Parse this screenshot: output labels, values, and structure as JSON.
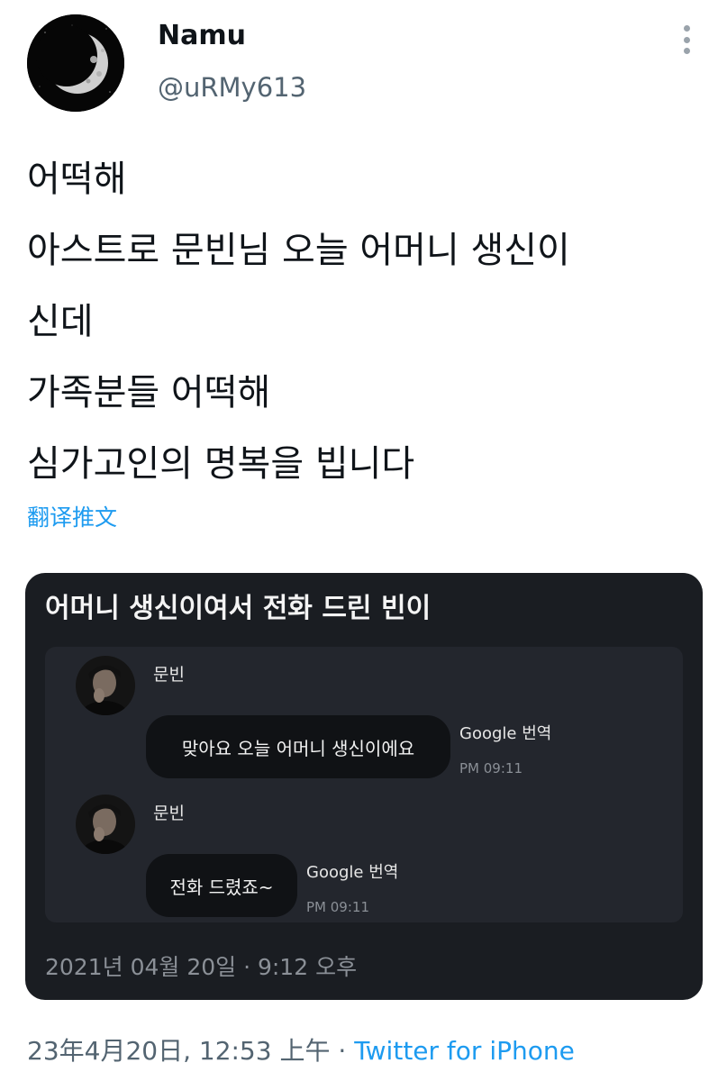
{
  "tweet": {
    "author": {
      "display_name": "Namu",
      "handle": "@uRMy613",
      "avatar_icon": "moon-avatar"
    },
    "more_icon": "more-vertical-icon",
    "text_lines": [
      "어떡해",
      "아스트로 문빈님 오늘 어머니 생신이",
      "신데",
      "가족분들 어떡해",
      "심가고인의 명복을 빕니다"
    ],
    "translate_label": "翻译推文",
    "timestamp": "23年4月20日, 12:53 上午",
    "separator": "·",
    "source": "Twitter for iPhone"
  },
  "media": {
    "title": "어머니 생신이여서 전화 드린 빈이",
    "messages": [
      {
        "sender": "문빈",
        "text": "맞아요 오늘 어머니 생신이에요",
        "translate": "Google 번역",
        "time": "PM 09:11"
      },
      {
        "sender": "문빈",
        "text": "전화 드렸죠~",
        "translate": "Google 번역",
        "time": "PM 09:11"
      }
    ],
    "date_footer": "2021년 04월 20일 · 9:12 오후"
  },
  "colors": {
    "link": "#1d9bf0",
    "text": "#0f1419",
    "muted": "#536471",
    "card_bg": "#1a1d22"
  }
}
